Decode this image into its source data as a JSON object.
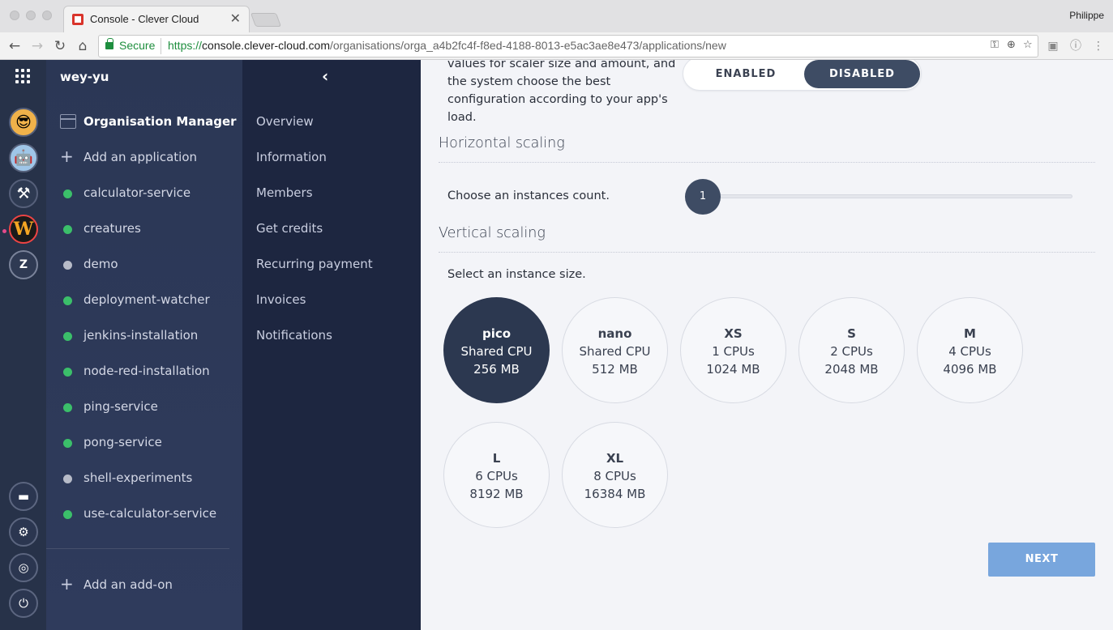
{
  "browser": {
    "tab_title": "Console - Clever Cloud",
    "tab_close": "✕",
    "profile": "Philippe",
    "secure_label": "Secure",
    "url_proto": "https://",
    "url_host": "console.clever-cloud.com",
    "url_path": "/organisations/orga_a4b2fc4f-f8ed-4188-8013-e5ac3ae8e473/applications/new"
  },
  "rail": {
    "orgs": [
      {
        "name": "avatar-developer",
        "glyph": "😎"
      },
      {
        "name": "avatar-robot",
        "glyph": "🤖"
      },
      {
        "name": "avatar-tool",
        "glyph": "⚒"
      },
      {
        "name": "avatar-w",
        "letter": "W"
      },
      {
        "name": "avatar-z",
        "letter": "Z"
      }
    ]
  },
  "sidebar": {
    "org_name": "wey-yu",
    "manager_label": "Organisation Manager",
    "add_app_label": "Add an application",
    "add_addon_label": "Add an add-on",
    "apps": [
      {
        "label": "calculator-service",
        "status": "green"
      },
      {
        "label": "creatures",
        "status": "green"
      },
      {
        "label": "demo",
        "status": "grey"
      },
      {
        "label": "deployment-watcher",
        "status": "green"
      },
      {
        "label": "jenkins-installation",
        "status": "green"
      },
      {
        "label": "node-red-installation",
        "status": "green"
      },
      {
        "label": "ping-service",
        "status": "green"
      },
      {
        "label": "pong-service",
        "status": "green"
      },
      {
        "label": "shell-experiments",
        "status": "grey"
      },
      {
        "label": "use-calculator-service",
        "status": "green"
      }
    ]
  },
  "menu": {
    "items": [
      "Overview",
      "Information",
      "Members",
      "Get credits",
      "Recurring payment",
      "Invoices",
      "Notifications"
    ]
  },
  "main": {
    "autoscale_desc": "values for scaler size and amount, and the system choose the best configuration according to your app's load.",
    "toggle_enabled": "ENABLED",
    "toggle_disabled": "DISABLED",
    "horizontal_title": "Horizontal scaling",
    "instances_label": "Choose an instances count.",
    "instances_value": "1",
    "vertical_title": "Vertical scaling",
    "size_label": "Select an instance size.",
    "sizes": [
      {
        "name": "pico",
        "cpu": "Shared CPU",
        "mem": "256 MB",
        "selected": true
      },
      {
        "name": "nano",
        "cpu": "Shared CPU",
        "mem": "512 MB"
      },
      {
        "name": "XS",
        "cpu": "1 CPUs",
        "mem": "1024 MB"
      },
      {
        "name": "S",
        "cpu": "2 CPUs",
        "mem": "2048 MB"
      },
      {
        "name": "M",
        "cpu": "4 CPUs",
        "mem": "4096 MB"
      },
      {
        "name": "L",
        "cpu": "6 CPUs",
        "mem": "8192 MB"
      },
      {
        "name": "XL",
        "cpu": "8 CPUs",
        "mem": "16384 MB"
      }
    ],
    "next_label": "NEXT"
  },
  "colors": {
    "accent": "#3e4c64",
    "next_button": "#78a6dd",
    "status_green": "#3bbf6a",
    "status_grey": "#b7bbc8"
  }
}
